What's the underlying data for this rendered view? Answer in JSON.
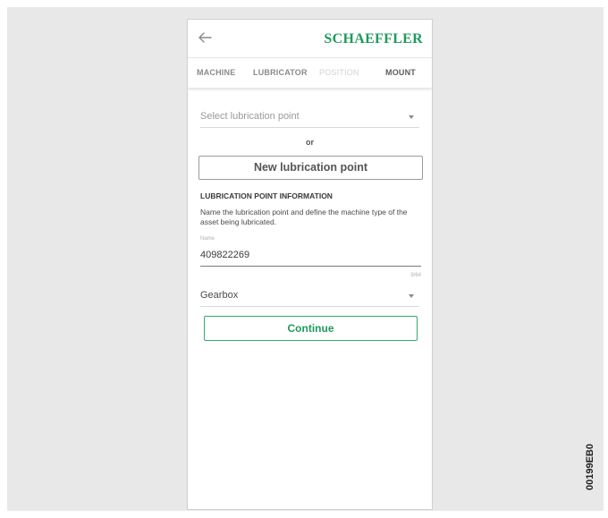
{
  "appbar": {
    "brand": "SCHAEFFLER",
    "back_icon": "arrow-left-icon"
  },
  "tabs": [
    {
      "label": "MACHINE",
      "state": "done"
    },
    {
      "label": "LUBRICATOR",
      "state": "done"
    },
    {
      "label": "POSITION",
      "state": "current"
    },
    {
      "label": "MOUNT",
      "state": "upcoming"
    }
  ],
  "form": {
    "select_point_placeholder": "Select lubrication point",
    "or_label": "or",
    "new_point_button": "New lubrication point",
    "section_title": "LUBRICATION POINT INFORMATION",
    "section_description": "Name the lubrication point and define the machine type of the asset being lubricated.",
    "name_label": "Name",
    "name_value": "409822269",
    "name_counter": "9/64",
    "machine_type_value": "Gearbox",
    "continue_button": "Continue"
  },
  "figure_code": "00199EB0",
  "colors": {
    "brand_green": "#1f9a5c",
    "background": "#e8e8e8"
  }
}
